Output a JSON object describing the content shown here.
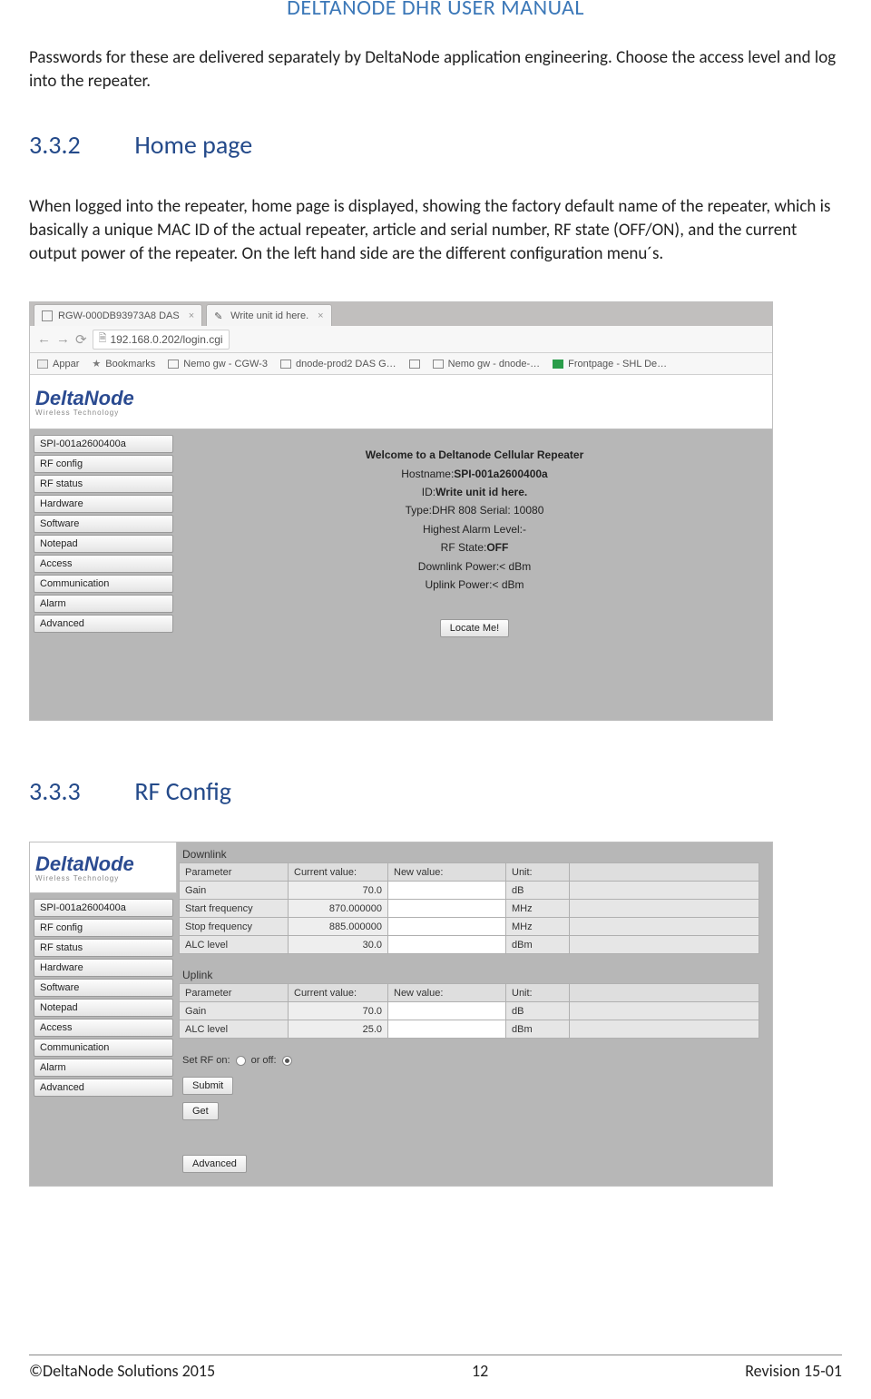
{
  "doc": {
    "header": "DELTANODE DHR USER MANUAL",
    "intro_para": "Passwords for these are delivered separately by DeltaNode application engineering. Choose the access level and log into the repeater.",
    "sec332_num": "3.3.2",
    "sec332_title": "Home page",
    "sec332_para": "When logged into the repeater, home page is displayed, showing the factory default name of the repeater, which is basically a unique MAC ID of the actual repeater, article and serial number, RF state (OFF/ON), and the current output power of the repeater. On the left hand side are the different configuration menu´s.",
    "sec333_num": "3.3.3",
    "sec333_title": "RF Config",
    "footer_left": "©DeltaNode Solutions 2015",
    "footer_center": "12",
    "footer_right": "Revision 15-01"
  },
  "scr1": {
    "tab1": "RGW-000DB93973A8 DAS",
    "tab2": "Write unit id here.",
    "url": "192.168.0.202/login.cgi",
    "bm": {
      "appar": "Appar",
      "bookmarks": "Bookmarks",
      "nemo1": "Nemo gw - CGW-3",
      "dnode": "dnode-prod2 DAS G…",
      "nemo2": "Nemo gw - dnode-…",
      "front": "Frontpage - SHL De…"
    },
    "logo_brand": "DeltaNode",
    "logo_tag": "Wireless Technology",
    "menu": [
      "SPI-001a2600400a",
      "RF config",
      "RF status",
      "Hardware",
      "Software",
      "Notepad",
      "Access",
      "Communication",
      "Alarm",
      "Advanced"
    ],
    "welcome_title": "Welcome to a Deltanode Cellular Repeater",
    "rows": [
      {
        "l": "Hostname:",
        "v": "SPI-001a2600400a",
        "vb": true
      },
      {
        "l": "ID:",
        "v": "Write unit id here.",
        "vb": true
      },
      {
        "l": "Type:",
        "v": "DHR 808 Serial:  10080",
        "vb": false
      },
      {
        "l": "Highest Alarm Level:",
        "v": "-",
        "vb": false
      },
      {
        "l": "RF State:",
        "v": "OFF",
        "vb": true
      },
      {
        "l": "Downlink Power:",
        "v": "<  dBm",
        "vb": false
      },
      {
        "l": "Uplink Power:",
        "v": "<  dBm",
        "vb": false
      }
    ],
    "locate": "Locate Me!"
  },
  "scr2": {
    "logo_brand": "DeltaNode",
    "logo_tag": "Wireless Technology",
    "menu": [
      "SPI-001a2600400a",
      "RF config",
      "RF status",
      "Hardware",
      "Software",
      "Notepad",
      "Access",
      "Communication",
      "Alarm",
      "Advanced"
    ],
    "dl_title": "Downlink",
    "hdr": {
      "p": "Parameter",
      "c": "Current value:",
      "n": "New value:",
      "u": "Unit:"
    },
    "dl_rows": [
      {
        "p": "Gain",
        "c": "70.0",
        "u": "dB"
      },
      {
        "p": "Start frequency",
        "c": "870.000000",
        "u": "MHz"
      },
      {
        "p": "Stop frequency",
        "c": "885.000000",
        "u": "MHz"
      },
      {
        "p": "ALC level",
        "c": "30.0",
        "u": "dBm"
      }
    ],
    "ul_title": "Uplink",
    "ul_rows": [
      {
        "p": "Gain",
        "c": "70.0",
        "u": "dB"
      },
      {
        "p": "ALC level",
        "c": "25.0",
        "u": "dBm"
      }
    ],
    "rf_set_lbl": "Set RF on:",
    "rf_off_lbl": "or off:",
    "btn_submit": "Submit",
    "btn_get": "Get",
    "btn_adv": "Advanced"
  }
}
